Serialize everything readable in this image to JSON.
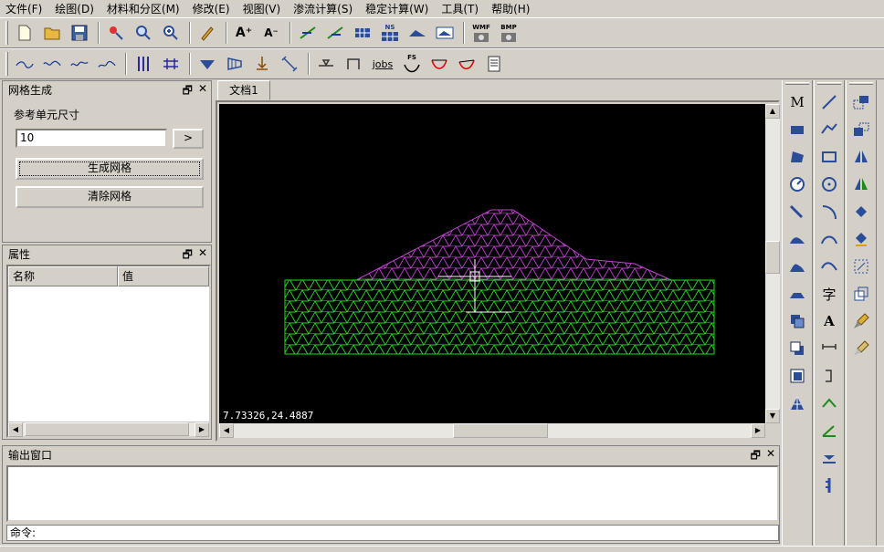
{
  "menu": [
    "文件(F)",
    "绘图(D)",
    "材料和分区(M)",
    "修改(E)",
    "视图(V)",
    "渗流计算(S)",
    "稳定计算(W)",
    "工具(T)",
    "帮助(H)"
  ],
  "toolbar1": {
    "icons": [
      "new-file-icon",
      "open-folder-icon",
      "save-icon",
      "select-pan-icon",
      "zoom-window-icon",
      "zoom-in-icon",
      "edit-pen-icon",
      "text-enlarge-icon",
      "text-shrink-icon",
      "line-style-icon",
      "line-style2-icon",
      "grid-table-icon",
      "ns-table-icon",
      "terrain-icon",
      "terrain-layers-icon",
      "wmf-camera-icon",
      "bmp-camera-icon"
    ],
    "text_big_a": "A⁺",
    "text_small_a": "A⁻",
    "ns_label": "NS",
    "wmf_label": "WMF",
    "bmp_label": "BMP"
  },
  "toolbar2": {
    "jobs_label": "jobs",
    "fs_label": "FS"
  },
  "mesh_panel": {
    "title": "网格生成",
    "ref_label": "参考单元尺寸",
    "ref_value": "10",
    "arrow_label": ">",
    "generate_label": "生成网格",
    "clear_label": "清除网格",
    "ctrl_restore": "🗗",
    "ctrl_close": "✕"
  },
  "prop_panel": {
    "title": "属性",
    "col_name": "名称",
    "col_value": "值",
    "ctrl_restore": "🗗",
    "ctrl_close": "✕"
  },
  "document": {
    "tab_label": "文档1",
    "coordinate_readout": "7.73326,24.4887",
    "mesh_colors": {
      "embankment": "#c040d0",
      "foundation": "#1fe01f",
      "background": "#000000"
    }
  },
  "output_panel": {
    "title": "输出窗口",
    "command_prompt": "命令:",
    "ctrl_restore": "🗗",
    "ctrl_close": "✕"
  },
  "right_tools": {
    "col1_text_m": "M",
    "col2_text_zi": "字",
    "col2_text_a": "A"
  }
}
